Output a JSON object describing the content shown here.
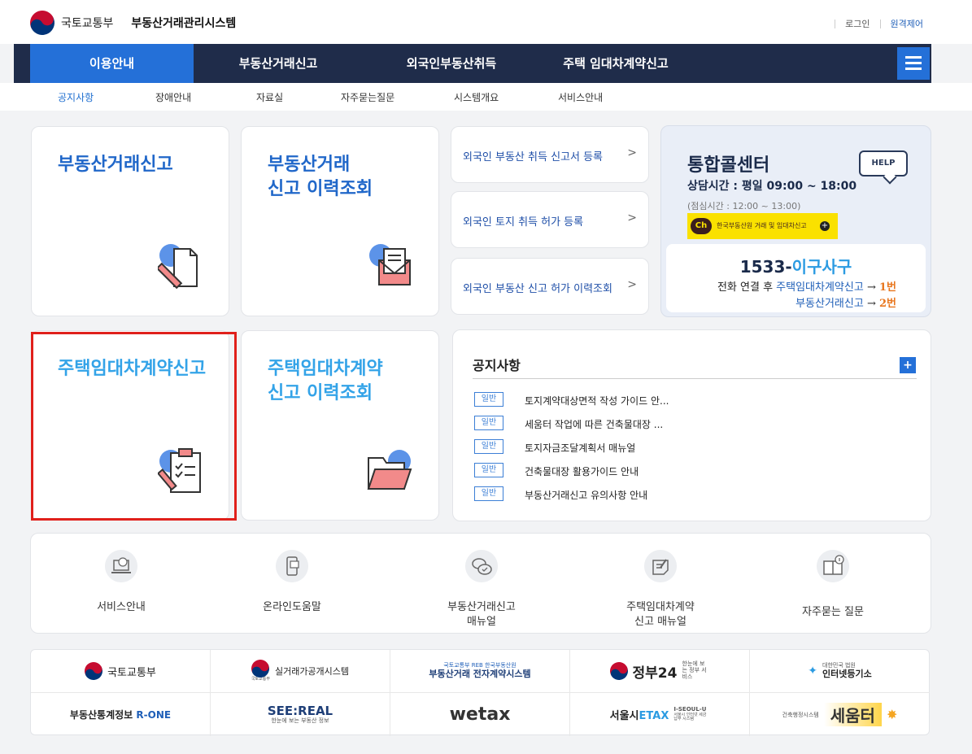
{
  "header": {
    "ministry": "국토교통부",
    "system_name": "부동산거래관리시스템",
    "login": "로그인",
    "remote": "원격제어"
  },
  "gnb": {
    "items": [
      "이용안내",
      "부동산거래신고",
      "외국인부동산취득",
      "주택 임대차계약신고"
    ]
  },
  "subnav": {
    "items": [
      "공지사항",
      "장애안내",
      "자료실",
      "자주묻는질문",
      "시스템개요",
      "서비스안내"
    ]
  },
  "cards": {
    "trade_report": "부동산거래신고",
    "trade_history_1": "부동산거래",
    "trade_history_2": "신고 이력조회",
    "lease_report": "주택임대차계약신고",
    "lease_history_1": "주택임대차계약",
    "lease_history_2": "신고 이력조회"
  },
  "foreign_links": [
    "외국인 부동산 취득 신고서 등록",
    "외국인 토지 취득 허가 등록",
    "외국인 부동산 신고 허가 이력조회"
  ],
  "callcenter": {
    "title": "통합콜센터",
    "hours": "상담시간 : 평일 09:00 ~ 18:00",
    "lunch": "(점심시간 : 12:00 ~ 13:00)",
    "help": "HELP",
    "kakao_ch": "Ch",
    "kakao_text": "한국부동산원 거래 및 임대차신고",
    "kakao_plus": "+",
    "phone_num": "1533-",
    "phone_kr": "이구사구",
    "line1_pre": "전화 연결 후 ",
    "line1_link": "주택임대차계약신고",
    "line1_arrow": " → ",
    "line1_no": "1번",
    "line2_link": "부동산거래신고",
    "line2_arrow": " → ",
    "line2_no": "2번"
  },
  "notice": {
    "title": "공지사항",
    "plus": "+",
    "badge": "일반",
    "items": [
      "토지계약대상면적 작성 가이드 안...",
      "세움터 작업에 따른 건축물대장 ...",
      "토지자금조달계획서 매뉴얼",
      "건축물대장 활용가이드 안내",
      "부동산거래신고 유의사항 안내"
    ]
  },
  "services": [
    {
      "line1": "서비스안내",
      "line2": ""
    },
    {
      "line1": "온라인도움말",
      "line2": ""
    },
    {
      "line1": "부동산거래신고",
      "line2": "매뉴얼"
    },
    {
      "line1": "주택임대차계약",
      "line2": "신고 매뉴얼"
    },
    {
      "line1": "자주묻는 질문",
      "line2": ""
    }
  ],
  "partners": {
    "p1": "국토교통부",
    "p2": "실거래가공개시스템",
    "p2_sub": "국토교통부",
    "p3_top": "국토교통부 REB 한국부동산원",
    "p3": "부동산거래 전자계약시스템",
    "p4": "정부24",
    "p4_sub": "한눈에 보는 정부 서비스",
    "p5_sub": "대한민국 법원",
    "p5": "인터넷등기소",
    "p6_pre": "부동산통계정보 ",
    "p6_brand": "R-ONE",
    "p7": "SEE:REAL",
    "p7_sub": "한눈에 보는 부동산 정보",
    "p8": "wetax",
    "p9_pre": "서울시",
    "p9_brand": "ETAX",
    "p9_sub1": "I-SEOUL-U",
    "p9_sub2": "서울시 인터넷 세금납부 시스템",
    "p10_sub": "건축행정시스템",
    "p10": "세움터"
  },
  "colors": {
    "navy": "#1f2c4a",
    "accent_blue": "#2470d8",
    "title_blue": "#2067c9",
    "sky": "#33a3e8",
    "highlight_red": "#e0201b",
    "orange": "#e8761e"
  }
}
